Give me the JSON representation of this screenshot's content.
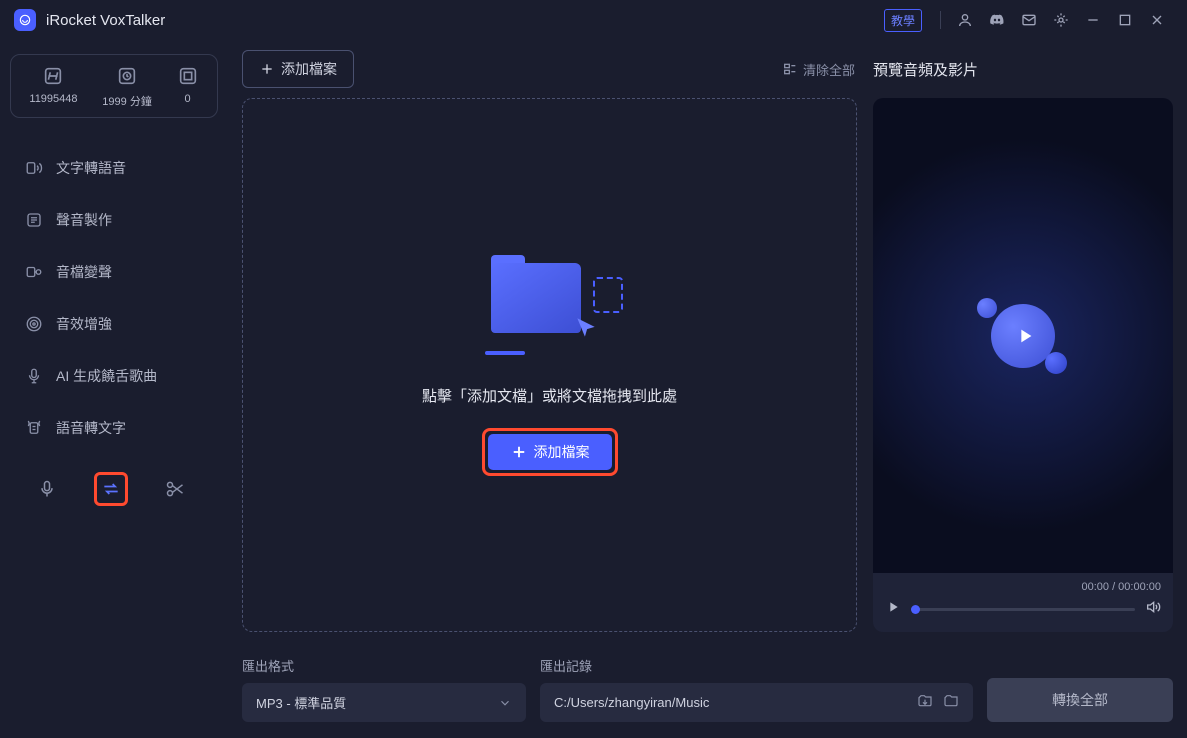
{
  "app": {
    "name": "iRocket VoxTalker"
  },
  "titlebar": {
    "tutorial": "教學"
  },
  "stats": [
    {
      "value": "11995448"
    },
    {
      "value": "1999 分鐘"
    },
    {
      "value": "0"
    }
  ],
  "nav": [
    {
      "label": "文字轉語音"
    },
    {
      "label": "聲音製作"
    },
    {
      "label": "音檔變聲"
    },
    {
      "label": "音效增強"
    },
    {
      "label": "AI 生成饒舌歌曲"
    },
    {
      "label": "語音轉文字"
    }
  ],
  "main": {
    "add_file_top": "添加檔案",
    "clear_all": "清除全部",
    "preview_title": "預覽音頻及影片",
    "drop_hint": "點擊「添加文檔」或將文檔拖拽到此處",
    "add_file_main": "添加檔案"
  },
  "preview": {
    "time": "00:00 / 00:00:00"
  },
  "export": {
    "format_label": "匯出格式",
    "format_value": "MP3 - 標準品質",
    "dir_label": "匯出記錄",
    "dir_value": "C:/Users/zhangyiran/Music",
    "convert_btn": "轉換全部"
  }
}
